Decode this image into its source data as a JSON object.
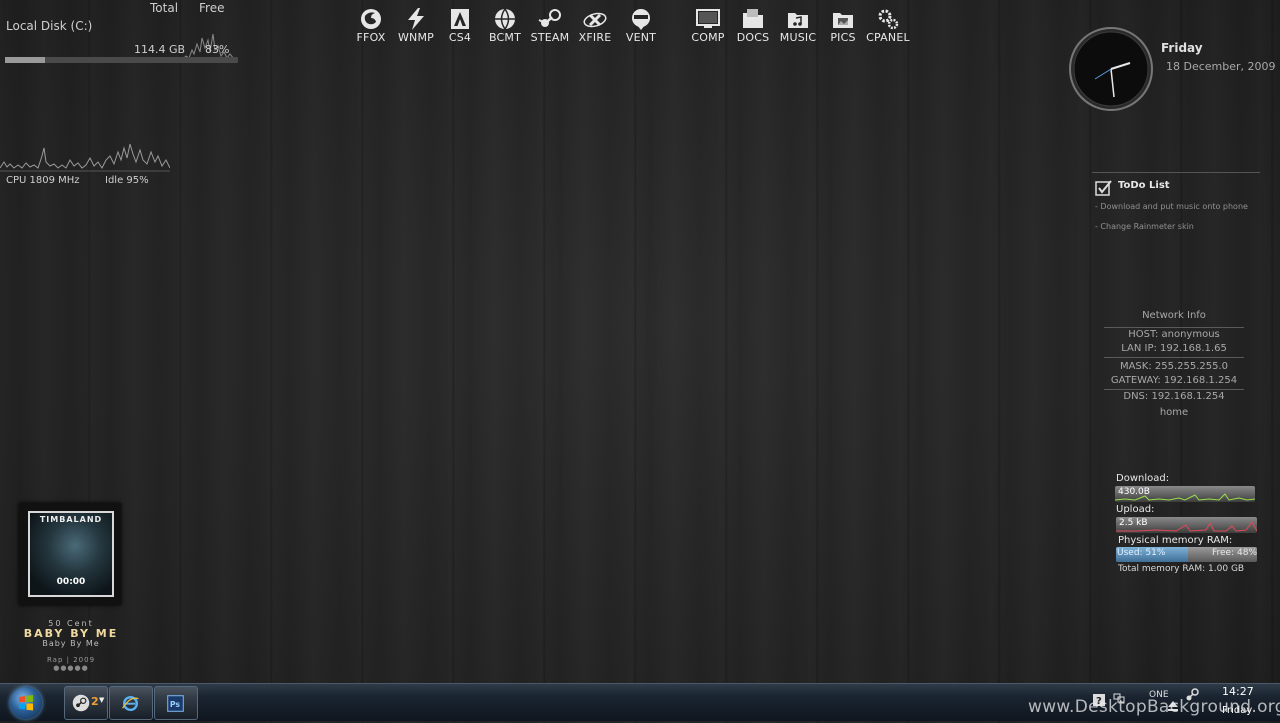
{
  "disk": {
    "header_total": "Total",
    "header_free": "Free",
    "label": "Local Disk (C:)",
    "total_value": "114.4 GB",
    "free_percent": "83%",
    "used_fraction": 0.17
  },
  "cpu": {
    "speed_label": "CPU 1809 MHz",
    "idle_label": "Idle 95%"
  },
  "launcher": [
    {
      "label": "FFOX",
      "icon": "firefox-icon"
    },
    {
      "label": "WNMP",
      "icon": "lightning-icon"
    },
    {
      "label": "CS4",
      "icon": "adobe-icon"
    },
    {
      "label": "BCMT",
      "icon": "globe-icon"
    },
    {
      "label": "STEAM",
      "icon": "steam-icon"
    },
    {
      "label": "XFIRE",
      "icon": "xfire-icon"
    },
    {
      "label": "VENT",
      "icon": "ventrilo-icon"
    },
    {
      "label": "COMP",
      "icon": "monitor-icon"
    },
    {
      "label": "DOCS",
      "icon": "documents-folder-icon"
    },
    {
      "label": "MUSIC",
      "icon": "music-folder-icon"
    },
    {
      "label": "PICS",
      "icon": "pictures-folder-icon"
    },
    {
      "label": "CPANEL",
      "icon": "gears-icon"
    }
  ],
  "clock": {
    "day": "Friday",
    "date": "18 December, 2009"
  },
  "todo": {
    "title": "ToDo List",
    "items": [
      "- Download and put music onto phone",
      "- Change Rainmeter skin"
    ]
  },
  "network": {
    "title": "Network Info",
    "host": "HOST: anonymous",
    "lan_ip": "LAN IP: 192.168.1.65",
    "mask": "MASK: 255.255.255.0",
    "gateway": "GATEWAY: 192.168.1.254",
    "dns": "DNS: 192.168.1.254",
    "domain": "home"
  },
  "meters": {
    "download_label": "Download:",
    "download_value": "430.0B",
    "upload_label": "Upload:",
    "upload_value": "2.5 kB",
    "ram_label": "Physical memory RAM:",
    "ram_used": "Used: 51%",
    "ram_free": "Free: 48%",
    "ram_used_fraction": 0.51,
    "ram_total": "Total memory RAM:  1.00 GB"
  },
  "now_playing": {
    "cover_artist": "TIMBALAND",
    "cover_time": "00:00",
    "artist": "50 Cent",
    "title": "BABY BY ME",
    "album": "Baby By Me",
    "meta": "Rap | 2009",
    "rating_stars": "●●●●●"
  },
  "taskbar": {
    "steam_count": "2",
    "time": "14:27",
    "day": "Friday"
  },
  "watermark": "www.DesktopBackground.org",
  "colors": {
    "download_graph": "#9ae04a",
    "upload_graph": "#e04a5a",
    "ram_fill": "#5b8fb8"
  }
}
